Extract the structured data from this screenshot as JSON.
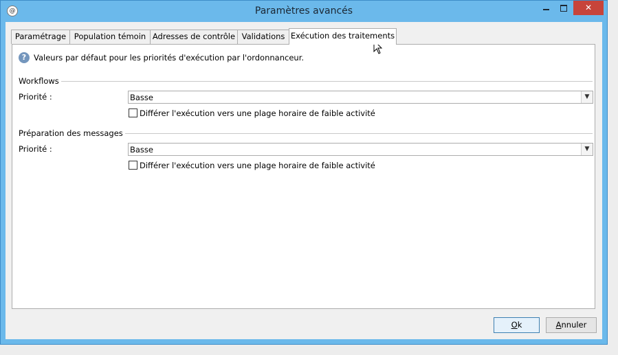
{
  "window": {
    "title": "Paramètres avancés",
    "app_icon_glyph": "@",
    "close_glyph": "✕"
  },
  "tabs": [
    {
      "label": "Paramétrage"
    },
    {
      "label": "Population témoin"
    },
    {
      "label": "Adresses de contrôle"
    },
    {
      "label": "Validations"
    },
    {
      "label": "Exécution des traitements",
      "active": true
    }
  ],
  "info": {
    "icon": "question-icon",
    "icon_glyph": "?",
    "text": "Valeurs par défaut pour les priorités d'exécution par l'ordonnanceur."
  },
  "workflows": {
    "title": "Workflows",
    "priority_label": "Priorité :",
    "priority_value": "Basse",
    "defer_label": "Différer l'exécution vers une plage horaire de faible activité",
    "defer_checked": false
  },
  "messages": {
    "title": "Préparation des messages",
    "priority_label": "Priorité :",
    "priority_value": "Basse",
    "defer_label": "Différer l'exécution vers une plage horaire de faible activité",
    "defer_checked": false
  },
  "buttons": {
    "ok_underlined": "O",
    "ok_rest": "k",
    "cancel_underlined": "A",
    "cancel_rest": "nnuler"
  },
  "colors": {
    "titlebar": "#6bb9eb",
    "close_button": "#c7443a",
    "info_icon": "#7496bd"
  }
}
